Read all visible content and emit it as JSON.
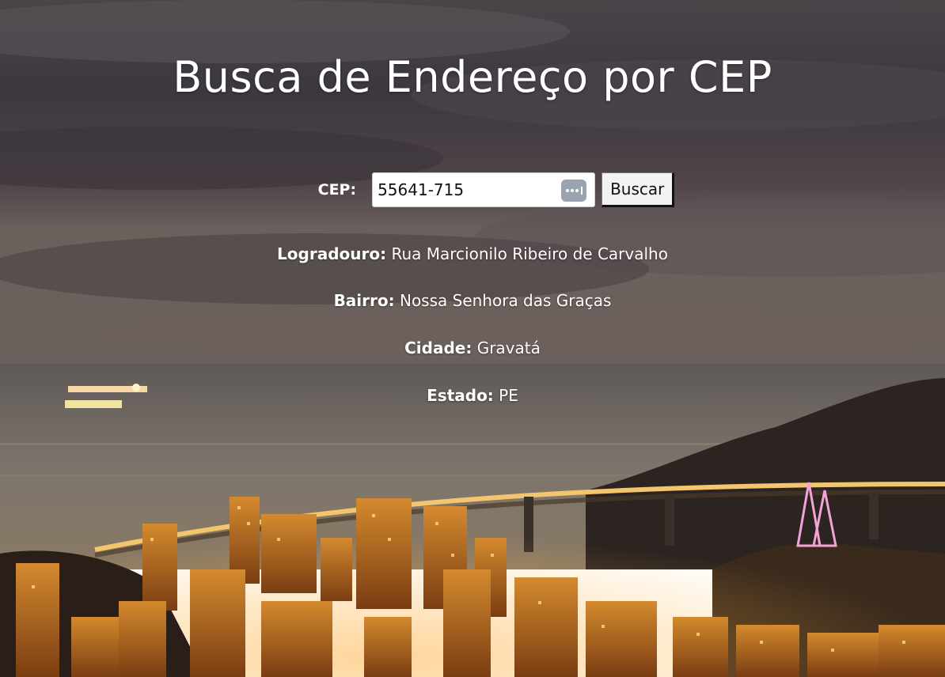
{
  "page": {
    "title": "Busca de Endereço por CEP"
  },
  "search": {
    "label": "CEP:",
    "value": "55641-715",
    "button_label": "Buscar",
    "autofill_icon": "password-dots-icon"
  },
  "results": {
    "logradouro_label": "Logradouro:",
    "logradouro_value": "Rua Marcionilo Ribeiro de Carvalho",
    "bairro_label": "Bairro:",
    "bairro_value": "Nossa Senhora das Graças",
    "cidade_label": "Cidade:",
    "cidade_value": "Gravatá",
    "estado_label": "Estado:",
    "estado_value": "PE"
  },
  "colors": {
    "sky_top": "#3f3a42",
    "sky_mid": "#5a4f52",
    "sea": "#6f6963",
    "city_light": "#f0a43a",
    "text": "#ffffff"
  }
}
